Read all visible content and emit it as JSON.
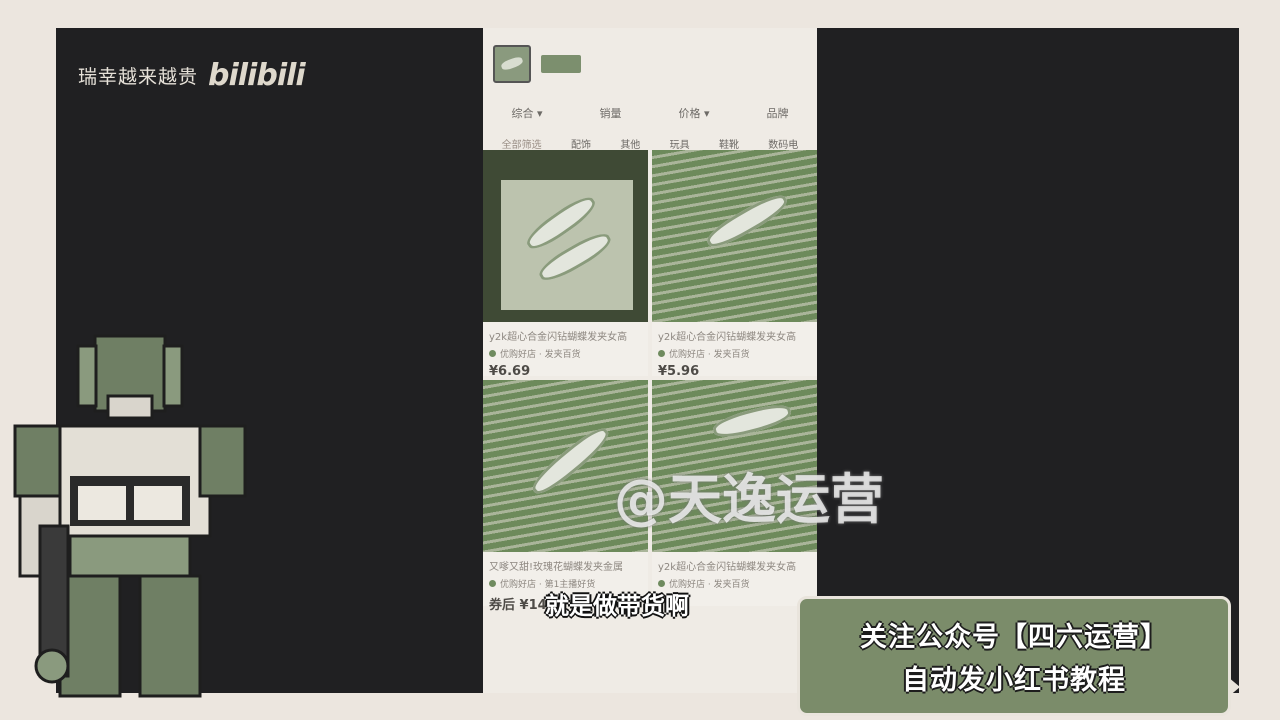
{
  "channel": {
    "name": "瑞幸越来越贵",
    "logo": "bilibili"
  },
  "phone": {
    "sort_tabs": [
      "综合 ▾",
      "销量",
      "价格 ▾",
      "品牌"
    ],
    "categories": [
      "全部筛选",
      "配饰",
      "其他",
      "玩具",
      "鞋靴",
      "数码电"
    ],
    "products": [
      {
        "title": "y2k超心合金闪钻蝴蝶发夹女高",
        "shop": "优购好店 · 发夹百货",
        "price": "¥6.69"
      },
      {
        "title": "y2k超心合金闪钻蝴蝶发夹女高",
        "shop": "优购好店 · 发夹百货",
        "price": "¥5.96"
      },
      {
        "title": "又嗲又甜!玫瑰花蝴蝶发夹金属",
        "shop": "优购好店 · 第1主播好货",
        "price": "券后 ¥14.9"
      },
      {
        "title": "y2k超心合金闪钻蝴蝶发夹女高",
        "shop": "优购好店 · 发夹百货",
        "price": ""
      }
    ]
  },
  "watermark": "@天逸运营",
  "subtitle": "就是做带货啊",
  "promo": {
    "line1": "关注公众号【四六运营】",
    "line2": "自动发小红书教程"
  },
  "colors": {
    "frame": "#ece6df",
    "stage": "#202022",
    "promo_bg": "#7b8c6a",
    "accent_green": "#6f8b5f"
  }
}
